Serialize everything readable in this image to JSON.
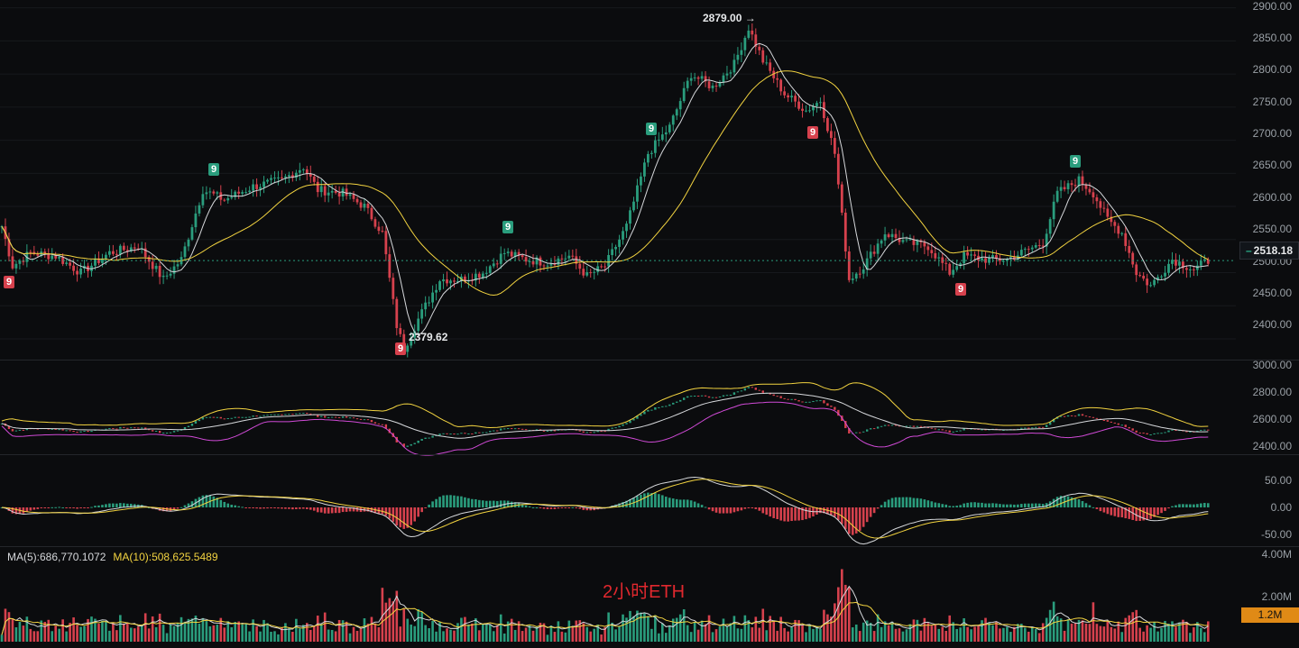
{
  "caption": "2小时ETH",
  "colors": {
    "background": "#0b0c0e",
    "up": "#2a9d7d",
    "down": "#d6414d",
    "ma_white": "#d6d8db",
    "ma_yellow": "#f2d340",
    "boll_lower": "#d04ad6",
    "vol_tag_bg": "#e08a16"
  },
  "price_pane": {
    "axis_labels": [
      "2900.00",
      "2850.00",
      "2800.00",
      "2750.00",
      "2700.00",
      "2650.00",
      "2600.00",
      "2550.00",
      "2500.00",
      "2450.00",
      "2400.00"
    ],
    "current_price": "2518.18",
    "high_annotation": "2879.00 →",
    "low_annotation": "2379.62",
    "td_markers": [
      {
        "label": "9",
        "kind": "down",
        "bar": 2
      },
      {
        "label": "9",
        "kind": "up",
        "bar": 59
      },
      {
        "label": "9",
        "kind": "down",
        "bar": 111
      },
      {
        "label": "9",
        "kind": "up",
        "bar": 141
      },
      {
        "label": "9",
        "kind": "up",
        "bar": 181
      },
      {
        "label": "9",
        "kind": "down",
        "bar": 226
      },
      {
        "label": "9",
        "kind": "down",
        "bar": 267
      },
      {
        "label": "9",
        "kind": "up",
        "bar": 299
      }
    ]
  },
  "boll_pane": {
    "axis_labels": [
      "3000.00",
      "2800.00",
      "2600.00",
      "2400.00"
    ]
  },
  "macd_pane": {
    "axis_labels": [
      "50.00",
      "0.00",
      "-50.00"
    ]
  },
  "volume_pane": {
    "axis_labels": [
      "4.00M",
      "2.00M"
    ],
    "current_volume": "1.2M",
    "ma5_label": "MA(5):686,770.1072",
    "ma10_label": "MA(10):508,625.5489"
  },
  "chart_data": {
    "type": "candlestick",
    "symbol": "ETH",
    "interval": "2h",
    "ylim": [
      2370,
      2905
    ],
    "anchors": [
      [
        0,
        2570
      ],
      [
        3,
        2510
      ],
      [
        8,
        2530
      ],
      [
        15,
        2525
      ],
      [
        22,
        2500
      ],
      [
        30,
        2530
      ],
      [
        38,
        2540
      ],
      [
        45,
        2490
      ],
      [
        50,
        2520
      ],
      [
        56,
        2625
      ],
      [
        62,
        2610
      ],
      [
        70,
        2630
      ],
      [
        78,
        2640
      ],
      [
        84,
        2660
      ],
      [
        88,
        2625
      ],
      [
        95,
        2620
      ],
      [
        101,
        2600
      ],
      [
        106,
        2560
      ],
      [
        110,
        2420
      ],
      [
        112,
        2385
      ],
      [
        116,
        2430
      ],
      [
        122,
        2490
      ],
      [
        128,
        2490
      ],
      [
        134,
        2500
      ],
      [
        140,
        2530
      ],
      [
        146,
        2520
      ],
      [
        152,
        2515
      ],
      [
        158,
        2525
      ],
      [
        163,
        2495
      ],
      [
        168,
        2510
      ],
      [
        174,
        2570
      ],
      [
        180,
        2680
      ],
      [
        186,
        2720
      ],
      [
        192,
        2800
      ],
      [
        198,
        2780
      ],
      [
        204,
        2815
      ],
      [
        208,
        2870
      ],
      [
        212,
        2820
      ],
      [
        218,
        2770
      ],
      [
        224,
        2745
      ],
      [
        228,
        2760
      ],
      [
        232,
        2680
      ],
      [
        236,
        2490
      ],
      [
        240,
        2510
      ],
      [
        246,
        2560
      ],
      [
        252,
        2545
      ],
      [
        258,
        2540
      ],
      [
        264,
        2500
      ],
      [
        268,
        2525
      ],
      [
        274,
        2520
      ],
      [
        280,
        2520
      ],
      [
        286,
        2535
      ],
      [
        290,
        2545
      ],
      [
        294,
        2620
      ],
      [
        300,
        2640
      ],
      [
        304,
        2620
      ],
      [
        308,
        2580
      ],
      [
        312,
        2560
      ],
      [
        316,
        2500
      ],
      [
        320,
        2480
      ],
      [
        326,
        2520
      ],
      [
        332,
        2505
      ],
      [
        336,
        2518
      ]
    ]
  }
}
